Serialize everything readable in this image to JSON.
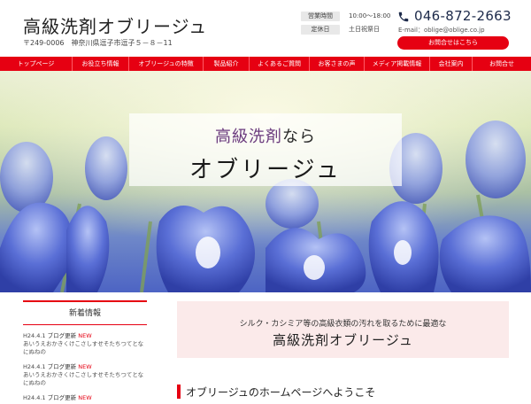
{
  "header": {
    "title": "高級洗剤オブリージュ",
    "address": "〒249-0006　神奈川県逗子市逗子５－８－11",
    "info": [
      {
        "label": "営業時間",
        "value": "10:00～18:00"
      },
      {
        "label": "定休日",
        "value": "土日祝祭日"
      }
    ],
    "phone_icon": "phone-icon",
    "phone": "046-872-2663",
    "email": "E-mail：oblige@oblige.co.jp",
    "contact_button": "お問合せはこちら"
  },
  "nav": {
    "items": [
      "トップページ",
      "お役立ち情報",
      "オブリージュの特徴",
      "製品紹介",
      "よくあるご質問",
      "お客さまの声",
      "メディア掲載情報",
      "会社案内",
      "お問合せ"
    ]
  },
  "hero": {
    "line1_accent": "高級洗剤",
    "line1_rest": "なら",
    "line2": "オブリージュ"
  },
  "news": {
    "heading": "新着情報",
    "items": [
      {
        "date": "H24.4.1",
        "tag": "ブログ更新",
        "new": "NEW",
        "body": "あいうえおかきくけこさしすせそたちつてとなにぬねの"
      },
      {
        "date": "H24.4.1",
        "tag": "ブログ更新",
        "new": "NEW",
        "body": "あいうえおかきくけこさしすせそたちつてとなにぬねの"
      },
      {
        "date": "H24.4.1",
        "tag": "ブログ更新",
        "new": "NEW",
        "body": ""
      }
    ]
  },
  "welcome": {
    "subtitle": "シルク・カシミア等の高級衣類の汚れを取るために最適な",
    "title": "高級洗剤オブリージュ"
  },
  "section": {
    "heading": "オブリージュのホームページへようこそ"
  },
  "colors": {
    "accent": "#e60012",
    "navy": "#1d2a4a",
    "pink_bg": "#fbeaea"
  }
}
